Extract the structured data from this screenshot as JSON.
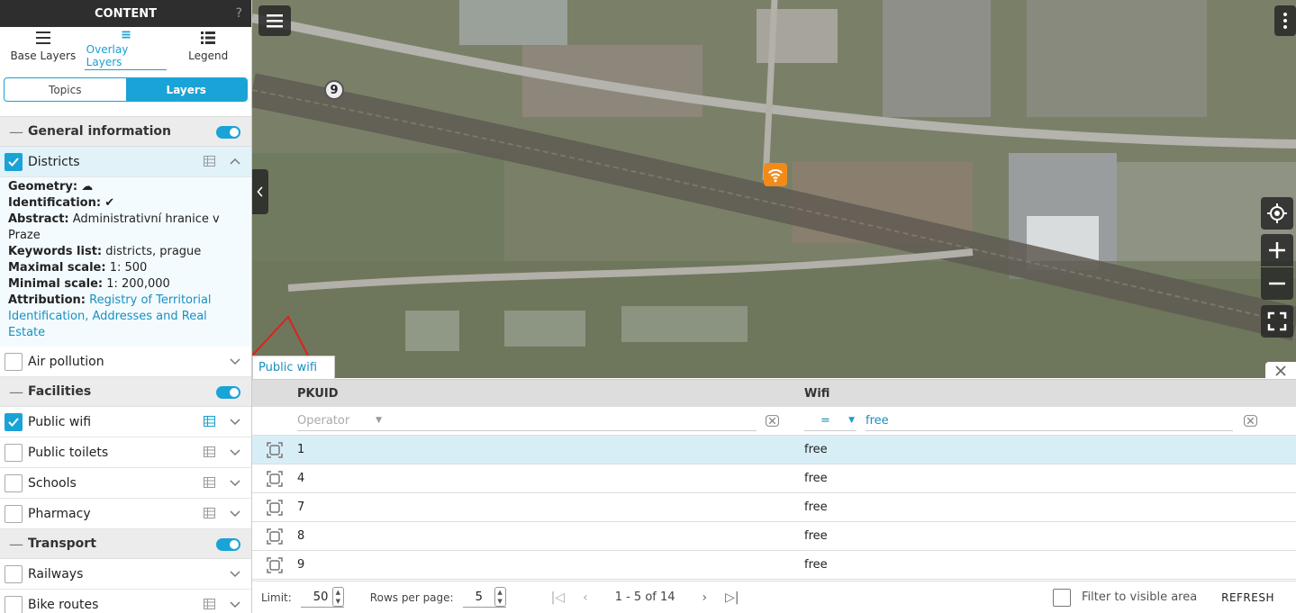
{
  "sidebar": {
    "title": "CONTENT",
    "help": "?",
    "tabs": [
      {
        "label": "Base Layers",
        "icon": "layers-stack-icon"
      },
      {
        "label": "Overlay Layers",
        "icon": "overlay-layers-icon",
        "active": true
      },
      {
        "label": "Legend",
        "icon": "legend-list-icon"
      }
    ],
    "segment": {
      "left": "Topics",
      "right": "Layers",
      "selected": "Layers"
    },
    "groups": {
      "general": {
        "label": "General information",
        "toggle": true,
        "districts": {
          "label": "Districts",
          "checked": true,
          "geometry_label": "Geometry:",
          "identification_label": "Identification:",
          "abstract_label": "Abstract:",
          "abstract_value": "Administrativní hranice v Praze",
          "keywords_label": "Keywords list:",
          "keywords_value": "districts, prague",
          "maxscale_label": "Maximal scale:",
          "maxscale_value": "1: 500",
          "minscale_label": "Minimal scale:",
          "minscale_value": "1: 200,000",
          "attribution_label": "Attribution:",
          "attribution_value": "Registry of Territorial Identification, Addresses and Real Estate"
        },
        "air_pollution": {
          "label": "Air pollution",
          "checked": false
        }
      },
      "facilities": {
        "label": "Facilities",
        "toggle": true,
        "items": [
          {
            "label": "Public wifi",
            "checked": true
          },
          {
            "label": "Public toilets",
            "checked": false
          },
          {
            "label": "Schools",
            "checked": false
          },
          {
            "label": "Pharmacy",
            "checked": false
          }
        ]
      },
      "transport": {
        "label": "Transport",
        "toggle": true,
        "items": [
          {
            "label": "Railways",
            "checked": false
          },
          {
            "label": "Bike routes",
            "checked": false
          }
        ]
      }
    }
  },
  "map": {
    "cluster_count": "9",
    "layer_tab": "Public wifi",
    "accent": "#1aa3d6",
    "marker_color": "#f28a1a"
  },
  "table": {
    "columns": {
      "pkuid": "PKUID",
      "wifi": "Wifi"
    },
    "filter": {
      "operator_placeholder": "Operator",
      "wifi_operator": "=",
      "wifi_value": "free"
    },
    "rows": [
      {
        "pkuid": "1",
        "wifi": "free"
      },
      {
        "pkuid": "4",
        "wifi": "free"
      },
      {
        "pkuid": "7",
        "wifi": "free"
      },
      {
        "pkuid": "8",
        "wifi": "free"
      },
      {
        "pkuid": "9",
        "wifi": "free"
      }
    ],
    "footer": {
      "limit_label": "Limit:",
      "limit_value": "50",
      "rows_label": "Rows per page:",
      "rows_value": "5",
      "page_info": "1 - 5 of 14",
      "filter_visible": "Filter to visible area",
      "refresh": "REFRESH"
    }
  }
}
